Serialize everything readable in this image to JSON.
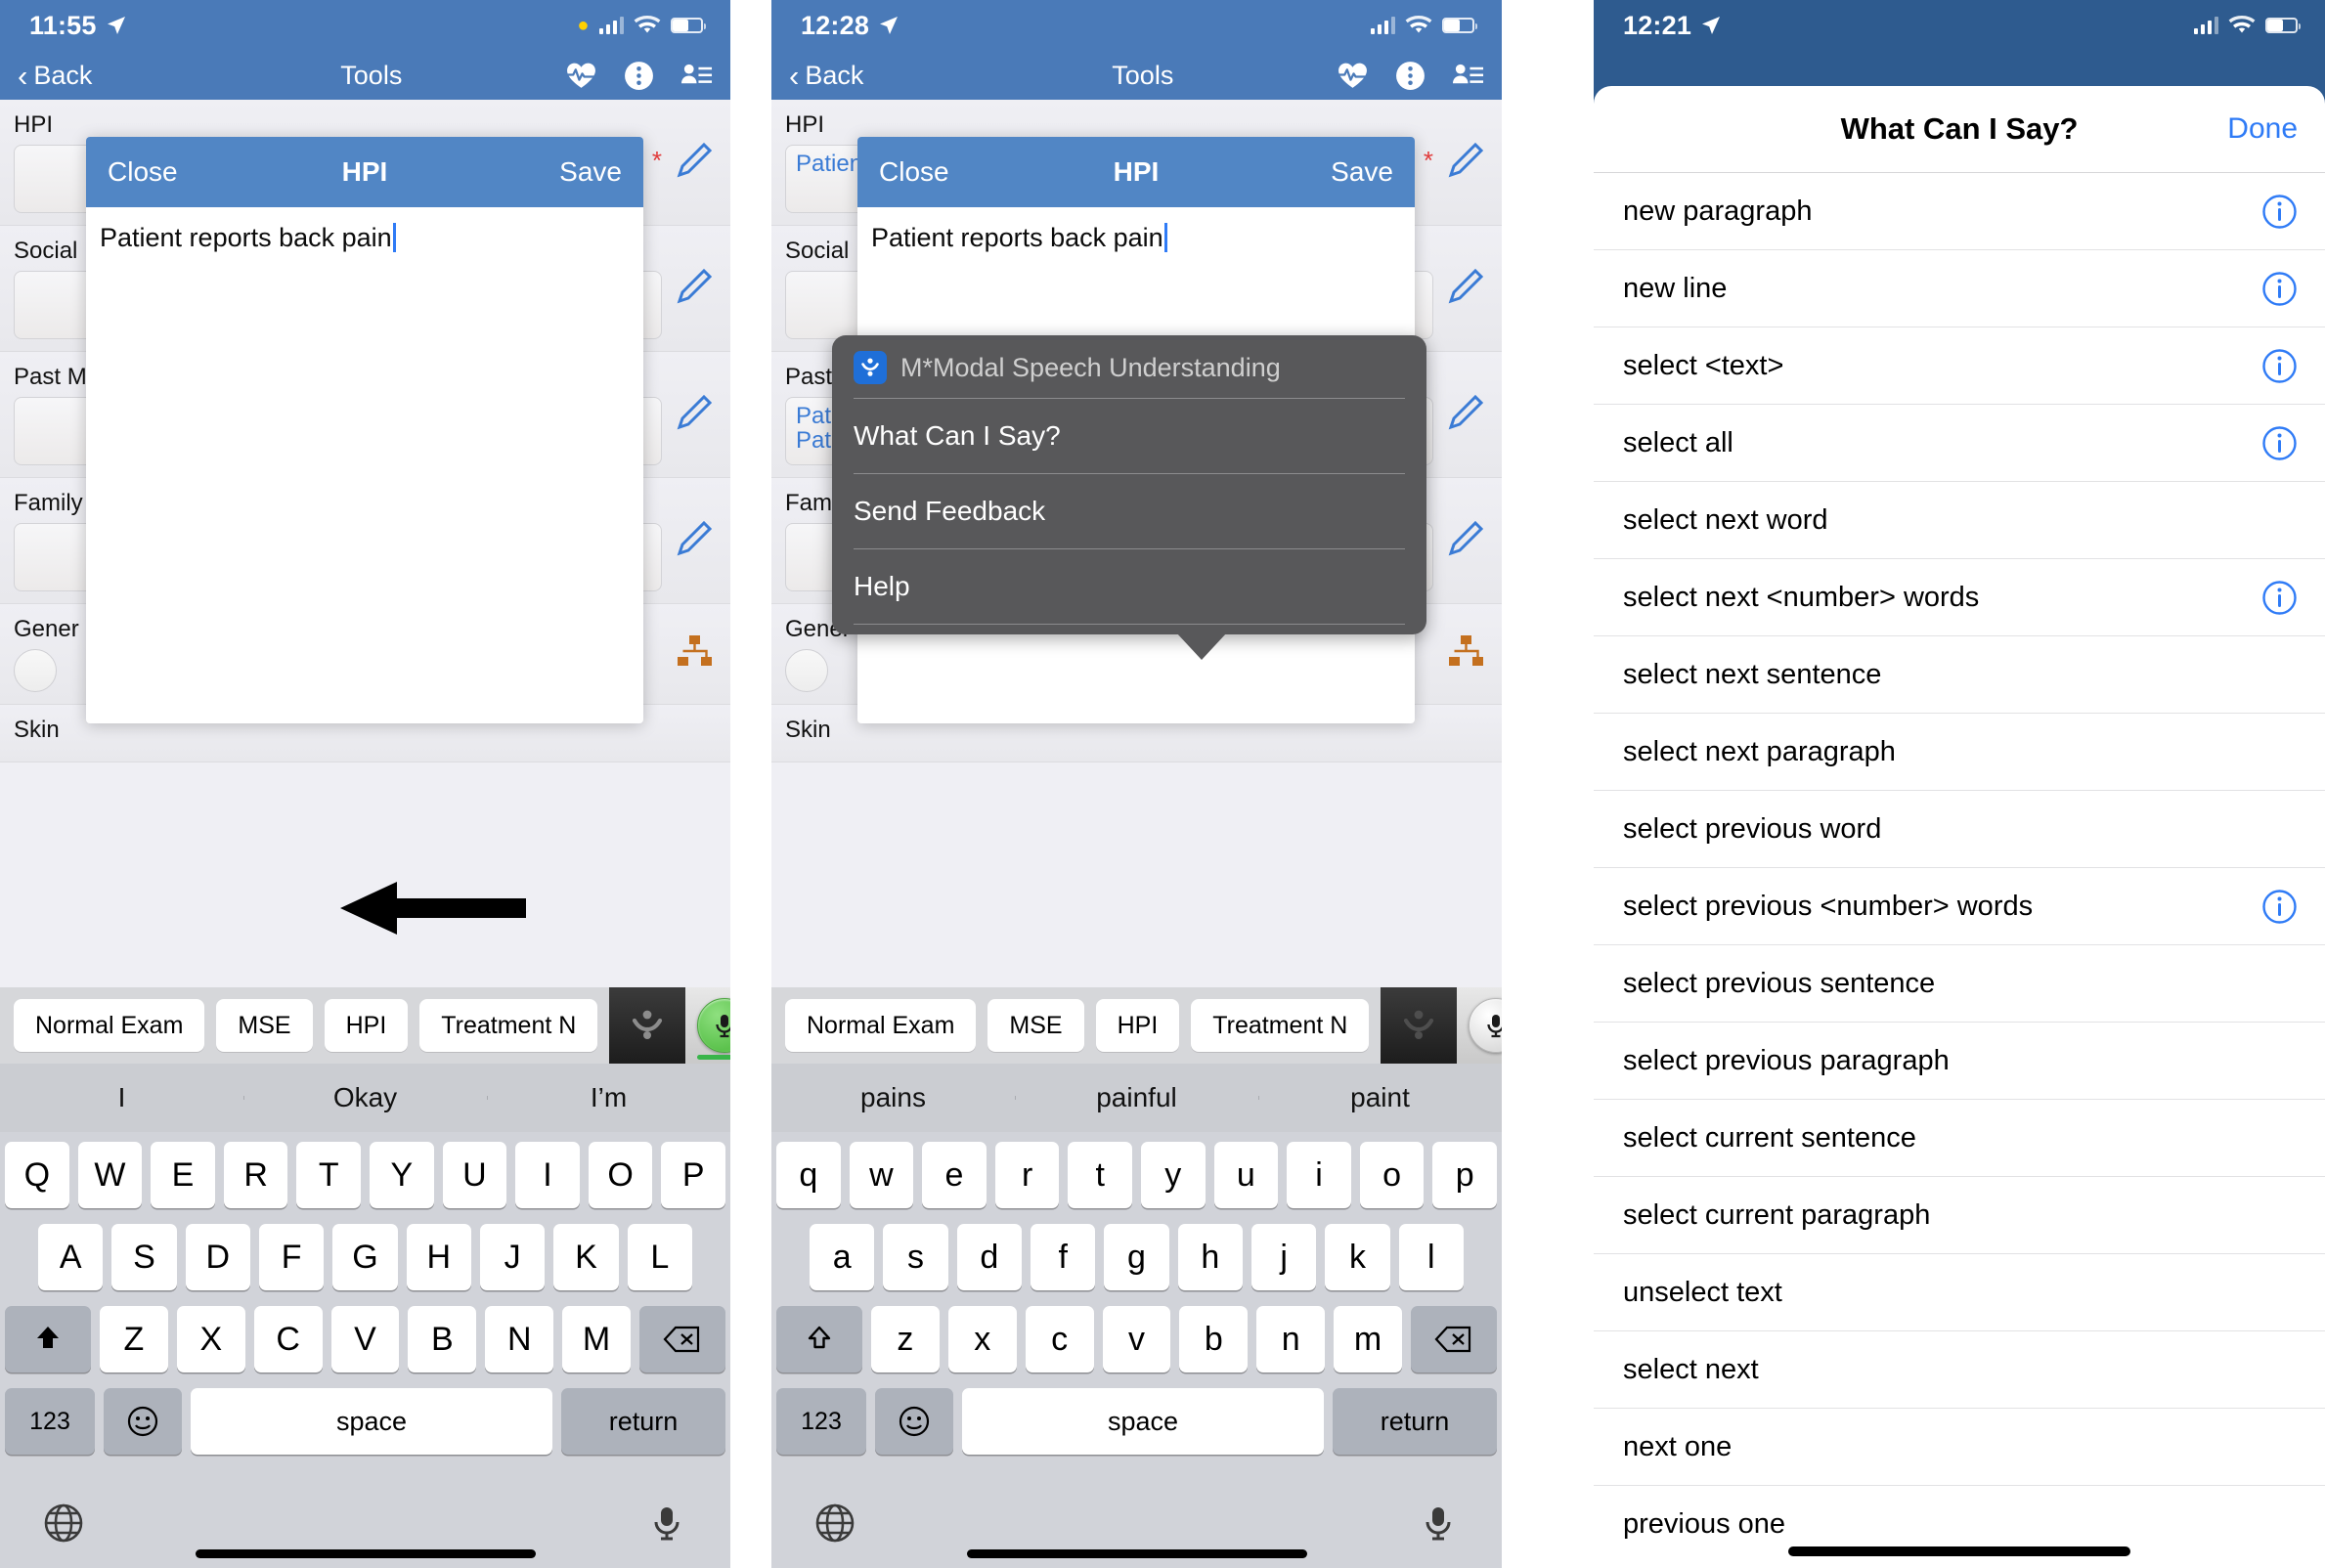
{
  "panels": [
    {
      "status": {
        "time": "11:55",
        "location_icon": "location-arrow-icon"
      },
      "nav": {
        "back": "Back",
        "title": "Tools",
        "icons": [
          "heartbeat-icon",
          "more-options-icon",
          "contacts-icon"
        ]
      },
      "form": {
        "rows": [
          {
            "label": "HPI",
            "value": "",
            "required": "*"
          },
          {
            "label": "Social",
            "value": ""
          },
          {
            "label": "Past M",
            "value": ""
          },
          {
            "label": "Family",
            "value": ""
          },
          {
            "label": "Gener",
            "value": ""
          },
          {
            "label": "Skin",
            "value": ""
          }
        ]
      },
      "modal": {
        "close": "Close",
        "title": "HPI",
        "save": "Save",
        "text": "Patient reports back pain"
      },
      "accessory": {
        "chips": [
          "Normal Exam",
          "MSE",
          "HPI",
          "Treatment N"
        ],
        "mmodal_icon": "mmodal-logo-icon",
        "mic_icon": "microphone-icon",
        "mic_state": "recording"
      },
      "predictions": [
        "I",
        "Okay",
        "I’m"
      ],
      "keyboard": {
        "row1": [
          "Q",
          "W",
          "E",
          "R",
          "T",
          "Y",
          "U",
          "I",
          "O",
          "P"
        ],
        "row2": [
          "A",
          "S",
          "D",
          "F",
          "G",
          "H",
          "J",
          "K",
          "L"
        ],
        "row3": [
          "Z",
          "X",
          "C",
          "V",
          "B",
          "N",
          "M"
        ],
        "shift": "shift-icon",
        "backspace": "backspace-icon",
        "numbers": "123",
        "emoji": "emoji-icon",
        "space": "space",
        "return": "return",
        "globe": "globe-icon",
        "dictation": "microphone-icon"
      }
    },
    {
      "status": {
        "time": "12:28",
        "location_icon": "location-arrow-icon"
      },
      "nav": {
        "back": "Back",
        "title": "Tools",
        "icons": [
          "heartbeat-icon",
          "more-options-icon",
          "contacts-icon"
        ]
      },
      "form": {
        "rows": [
          {
            "label": "HPI",
            "value": "Patien",
            "required": "*"
          },
          {
            "label": "Social",
            "value": ""
          },
          {
            "label": "Past M",
            "value": "Patien\nPatien"
          },
          {
            "label": "Family",
            "value": ""
          },
          {
            "label": "Gener",
            "value": ""
          },
          {
            "label": "Skin",
            "value": ""
          }
        ]
      },
      "modal": {
        "close": "Close",
        "title": "HPI",
        "save": "Save",
        "text": "Patient reports back pain"
      },
      "popover": {
        "header": "M*Modal Speech Understanding",
        "badge_icon": "mmodal-logo-icon",
        "items": [
          "What Can I Say?",
          "Send Feedback",
          "Help"
        ]
      },
      "accessory": {
        "chips": [
          "Normal Exam",
          "MSE",
          "HPI",
          "Treatment N"
        ],
        "mmodal_icon": "mmodal-logo-icon",
        "mic_icon": "microphone-icon",
        "mic_state": "idle"
      },
      "predictions": [
        "pains",
        "painful",
        "paint"
      ],
      "keyboard": {
        "row1": [
          "q",
          "w",
          "e",
          "r",
          "t",
          "y",
          "u",
          "i",
          "o",
          "p"
        ],
        "row2": [
          "a",
          "s",
          "d",
          "f",
          "g",
          "h",
          "j",
          "k",
          "l"
        ],
        "row3": [
          "z",
          "x",
          "c",
          "v",
          "b",
          "n",
          "m"
        ],
        "shift": "shift-icon",
        "backspace": "backspace-icon",
        "numbers": "123",
        "emoji": "emoji-icon",
        "space": "space",
        "return": "return",
        "globe": "globe-icon",
        "dictation": "microphone-icon"
      }
    },
    {
      "status": {
        "time": "12:21",
        "location_icon": "location-arrow-icon"
      },
      "sheet": {
        "title": "What Can I Say?",
        "done": "Done",
        "commands": [
          {
            "label": "new paragraph",
            "info": true
          },
          {
            "label": "new line",
            "info": true
          },
          {
            "label": "select <text>",
            "info": true
          },
          {
            "label": "select all",
            "info": true
          },
          {
            "label": "select next word",
            "info": false
          },
          {
            "label": "select next <number> words",
            "info": true
          },
          {
            "label": "select next sentence",
            "info": false
          },
          {
            "label": "select next paragraph",
            "info": false
          },
          {
            "label": "select previous word",
            "info": false
          },
          {
            "label": "select previous <number> words",
            "info": true
          },
          {
            "label": "select previous sentence",
            "info": false
          },
          {
            "label": "select previous paragraph",
            "info": false
          },
          {
            "label": "select current sentence",
            "info": false
          },
          {
            "label": "select current paragraph",
            "info": false
          },
          {
            "label": "unselect text",
            "info": false
          },
          {
            "label": "select next",
            "info": false
          },
          {
            "label": "next one",
            "info": false
          },
          {
            "label": "previous one",
            "info": false
          }
        ]
      }
    }
  ],
  "colors": {
    "nav_blue": "#4a7ab8",
    "modal_blue": "#5186c5",
    "sheet_blue": "#2e5b8f",
    "accent_blue": "#2f7bf6",
    "popover_grey": "#58585a",
    "mic_green": "#5cc24d",
    "required_red": "#e23c3c"
  }
}
